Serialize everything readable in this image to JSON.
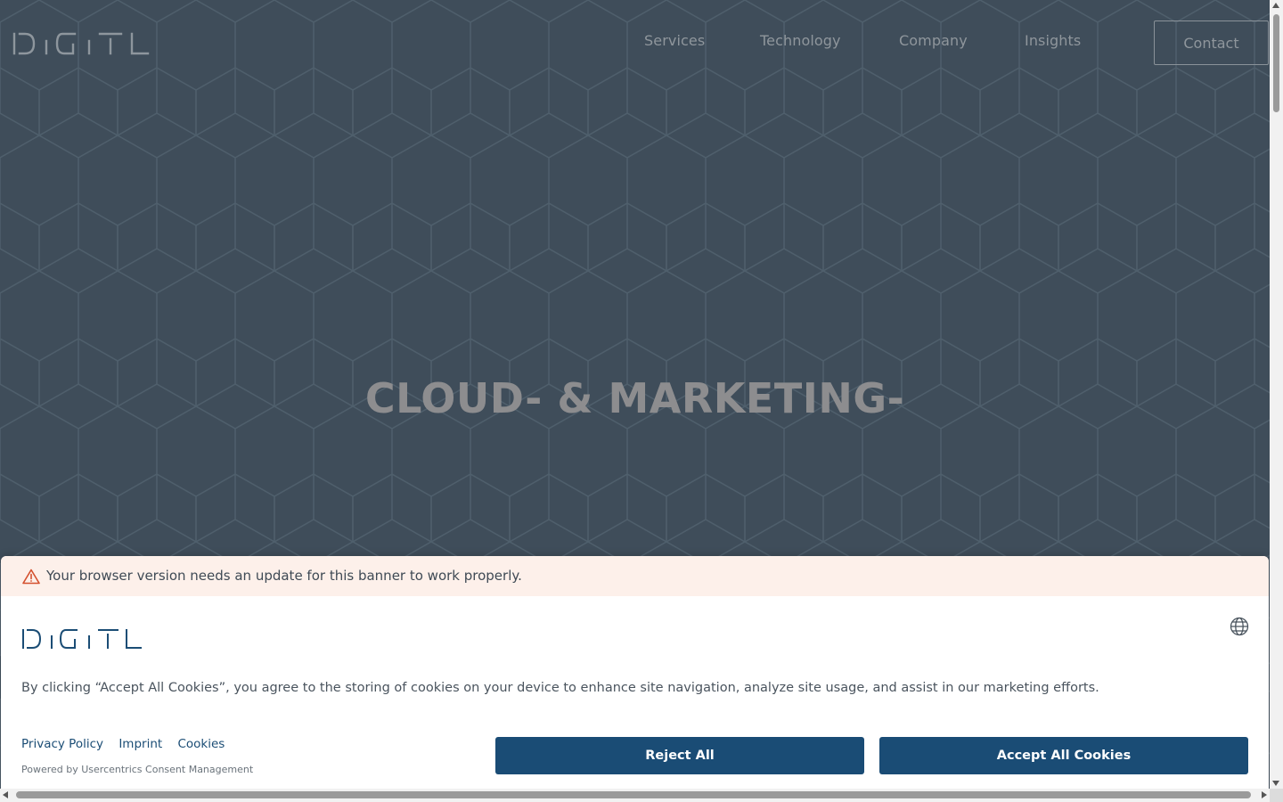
{
  "site": {
    "logo_text": "DIGITL"
  },
  "nav": {
    "items": [
      {
        "label": "Services"
      },
      {
        "label": "Technology"
      },
      {
        "label": "Company"
      },
      {
        "label": "Insights"
      }
    ],
    "contact_label": "Contact"
  },
  "hero": {
    "title": "CLOUD- & MARKETING-"
  },
  "cookie_banner": {
    "warning": "Your browser version needs an update for this banner to work properly.",
    "logo_text": "DIGITL",
    "consent_text": "By clicking “Accept All Cookies”, you agree to the storing of cookies on your device to enhance site navigation, analyze site usage, and assist in our marketing efforts.",
    "links": {
      "privacy": "Privacy Policy",
      "imprint": "Imprint",
      "cookies": "Cookies"
    },
    "powered_by": "Powered by Usercentrics Consent Management",
    "reject_label": "Reject All",
    "accept_label": "Accept All Cookies"
  },
  "colors": {
    "hero_bg": "#3f4d5a",
    "button_bg": "#1a4c75",
    "warning_bg": "#fdf0ea",
    "link": "#1b4d75"
  },
  "icons": [
    "warning-icon",
    "globe-icon"
  ]
}
